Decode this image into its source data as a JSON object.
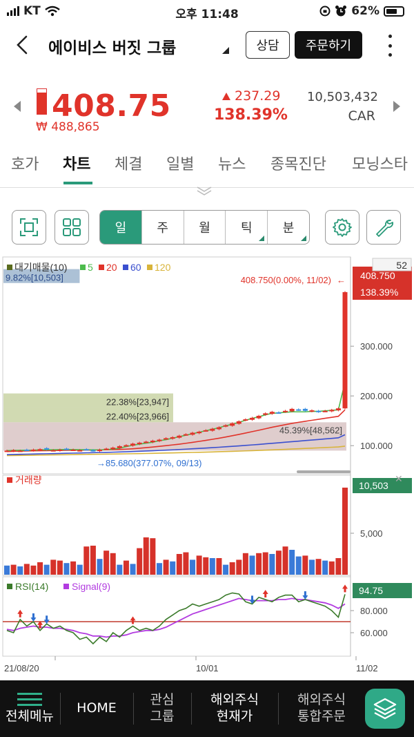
{
  "status_bar": {
    "carrier": "KT",
    "time": "오후 11:48",
    "battery": "62%",
    "icons": [
      "signal-icon",
      "wifi-icon",
      "rotation-lock-icon",
      "alarm-icon",
      "battery-icon"
    ]
  },
  "header": {
    "title": "에이비스 버짓 그룹",
    "consult_label": "상담",
    "order_label": "주문하기",
    "icons": [
      "back-chevron-icon",
      "dropdown-caret-icon",
      "more-vertical-icon"
    ]
  },
  "quote": {
    "price": "408.75",
    "krw_price": "₩ 488,865",
    "change": "237.29",
    "change_pct": "138.39%",
    "volume": "10,503,432",
    "ticker": "CAR",
    "day_range_fill": 0.85,
    "colors": {
      "up": "#e0332a",
      "accent": "#2a9a7a"
    }
  },
  "tabs": [
    {
      "label": "호가",
      "active": false
    },
    {
      "label": "차트",
      "active": true
    },
    {
      "label": "체결",
      "active": false
    },
    {
      "label": "일별",
      "active": false
    },
    {
      "label": "뉴스",
      "active": false
    },
    {
      "label": "종목진단",
      "active": false
    },
    {
      "label": "모닝스타",
      "active": false
    }
  ],
  "toolbar": {
    "periods": [
      {
        "label": "일",
        "active": true,
        "has_menu": false
      },
      {
        "label": "주",
        "active": false,
        "has_menu": false
      },
      {
        "label": "월",
        "active": false,
        "has_menu": false
      },
      {
        "label": "틱",
        "active": false,
        "has_menu": true
      },
      {
        "label": "분",
        "active": false,
        "has_menu": true
      }
    ],
    "icons": [
      "fullscreen-icon",
      "grid-layout-icon",
      "settings-gear-icon",
      "wrench-icon"
    ]
  },
  "chart_data": [
    {
      "type": "candlestick",
      "panel": "price",
      "legend": [
        {
          "name": "대기매물(10)",
          "color": "#5a6b1e"
        },
        {
          "name": "5",
          "color": "#4cbb4c"
        },
        {
          "name": "20",
          "color": "#e0332a"
        },
        {
          "name": "60",
          "color": "#3a4fcf"
        },
        {
          "name": "120",
          "color": "#d8b43a"
        }
      ],
      "ylim": [
        60,
        460
      ],
      "y_ticks": [
        "300.000",
        "200.000",
        "100.000"
      ],
      "x_ticks": [
        "21/08/20",
        "10/01",
        "11/02"
      ],
      "current_badge": {
        "price": "408.750",
        "pct": "138.39%"
      },
      "visible_count": "52",
      "high_label": "408.750(0.00%, 11/02)",
      "low_label": "85.680(377.07%, 09/13)",
      "volume_profile": [
        {
          "label": "9.82%[10,503]",
          "price_from": 427,
          "price_to": 455
        },
        {
          "label": "22.38%[23,947]",
          "price_from": 176,
          "price_to": 205
        },
        {
          "label": "22.40%[23,966]",
          "price_from": 147,
          "price_to": 176
        },
        {
          "label": "45.39%[48,562]",
          "price_from": 90,
          "price_to": 147
        }
      ],
      "close": [
        90,
        91,
        90,
        91,
        92,
        93,
        92,
        91,
        92,
        93,
        92,
        91,
        92,
        90,
        92,
        94,
        96,
        99,
        101,
        104,
        106,
        108,
        110,
        112,
        115,
        117,
        120,
        123,
        126,
        128,
        131,
        134,
        137,
        141,
        145,
        149,
        153,
        156,
        160,
        165,
        168,
        166,
        170,
        174,
        172,
        170,
        171,
        168,
        170,
        172,
        175,
        408.75
      ],
      "ma5": [
        90,
        90.5,
        90.6,
        90.8,
        91,
        91.5,
        91.7,
        91.7,
        92,
        92.2,
        92,
        91.8,
        91.8,
        91.6,
        91.4,
        92,
        93,
        95,
        98,
        101,
        103,
        105,
        107,
        110,
        112,
        115,
        118,
        121,
        124,
        127,
        130,
        133,
        136,
        140,
        143,
        147,
        151,
        155,
        158,
        162,
        165,
        166,
        167,
        168,
        168,
        168,
        169,
        169,
        170,
        171,
        172,
        228
      ],
      "ma20": [
        88,
        88.5,
        89,
        89.2,
        89.5,
        89.8,
        90,
        90.2,
        90.4,
        90.6,
        90.8,
        91,
        91,
        91.2,
        91.4,
        91.6,
        92,
        92.4,
        93,
        93.8,
        94.8,
        96,
        97.2,
        98.6,
        100,
        101.5,
        103,
        104.8,
        106.6,
        108.6,
        110.6,
        112.8,
        115,
        117.4,
        120,
        122.6,
        125.4,
        128.2,
        131,
        134,
        137,
        139.6,
        142.2,
        144.8,
        147,
        149,
        151,
        153,
        155,
        157,
        159,
        172
      ],
      "ma60": [
        82,
        82.3,
        82.6,
        82.9,
        83.2,
        83.5,
        83.8,
        84.1,
        84.4,
        84.7,
        85,
        85.3,
        85.6,
        85.9,
        86.2,
        86.5,
        86.9,
        87.3,
        87.7,
        88.2,
        88.7,
        89.2,
        89.8,
        90.4,
        91,
        91.6,
        92.3,
        93,
        93.7,
        94.4,
        95.2,
        96,
        96.8,
        97.7,
        98.6,
        99.5,
        100.5,
        101.5,
        102.5,
        103.6,
        104.7,
        105.8,
        106.9,
        108,
        109.1,
        110.2,
        111.3,
        112.4,
        113.5,
        114.6,
        115.8,
        122
      ],
      "ma120": [
        80,
        80.2,
        80.4,
        80.6,
        80.8,
        81,
        81.2,
        81.4,
        81.6,
        81.8,
        82,
        82.2,
        82.4,
        82.6,
        82.8,
        83,
        83.2,
        83.4,
        83.6,
        83.8,
        84,
        84.3,
        84.6,
        84.9,
        85.2,
        85.5,
        85.8,
        86.1,
        86.4,
        86.7,
        87,
        87.4,
        87.8,
        88.2,
        88.6,
        89,
        89.5,
        90,
        90.5,
        91,
        91.5,
        92,
        92.6,
        93.2,
        93.8,
        94.4,
        95,
        95.6,
        96.2,
        96.8,
        97.4,
        99
      ]
    },
    {
      "type": "bar",
      "panel": "volume",
      "legend": [
        {
          "name": "거래량",
          "color": "#e0332a"
        }
      ],
      "current_badge": "10,503",
      "y_ticks": [
        "5,000"
      ],
      "ylim": [
        0,
        11000
      ],
      "values": [
        1100,
        1200,
        1000,
        1300,
        1100,
        1500,
        1200,
        1800,
        1700,
        1400,
        1600,
        1200,
        3400,
        3500,
        1900,
        2900,
        2600,
        1200,
        1700,
        1300,
        3200,
        4500,
        4400,
        1400,
        1800,
        1600,
        2500,
        2700,
        1800,
        2300,
        2100,
        2000,
        2000,
        1200,
        1500,
        1800,
        2600,
        2300,
        2600,
        2700,
        2500,
        2900,
        3400,
        3000,
        2200,
        2300,
        1800,
        1900,
        1700,
        1600,
        2000,
        10503
      ],
      "up": [
        false,
        true,
        false,
        true,
        true,
        true,
        false,
        true,
        true,
        false,
        true,
        false,
        true,
        true,
        false,
        true,
        true,
        false,
        true,
        false,
        true,
        true,
        true,
        false,
        true,
        false,
        true,
        true,
        false,
        true,
        true,
        false,
        true,
        false,
        true,
        true,
        true,
        false,
        true,
        true,
        false,
        true,
        true,
        false,
        false,
        true,
        false,
        true,
        false,
        true,
        true,
        true
      ]
    },
    {
      "type": "line",
      "panel": "rsi",
      "legend": [
        {
          "name": "RSI(14)",
          "color": "#3a7a2a"
        },
        {
          "name": "Signal(9)",
          "color": "#b23be0"
        }
      ],
      "current_badge": "94.75",
      "y_ticks": [
        "80.000",
        "60.000"
      ],
      "ylim": [
        40,
        105
      ],
      "reference_level": 70,
      "rsi": [
        62,
        60,
        72,
        66,
        70,
        62,
        68,
        64,
        66,
        62,
        60,
        54,
        56,
        50,
        56,
        52,
        60,
        56,
        62,
        66,
        62,
        64,
        62,
        66,
        72,
        76,
        80,
        82,
        86,
        84,
        86,
        88,
        90,
        94,
        96,
        95,
        88,
        86,
        92,
        90,
        88,
        92,
        94,
        94,
        88,
        90,
        88,
        86,
        84,
        80,
        74,
        94.75
      ],
      "signal": [
        63,
        62,
        64,
        65,
        66,
        65,
        65,
        64,
        64,
        63,
        62,
        60,
        59,
        57,
        57,
        56,
        57,
        57,
        58,
        60,
        61,
        62,
        62,
        63,
        65,
        68,
        71,
        74,
        77,
        79,
        81,
        83,
        85,
        87,
        89,
        91,
        90,
        89,
        89,
        89,
        89,
        90,
        90,
        91,
        90,
        90,
        89,
        88,
        87,
        85,
        82,
        86
      ]
    }
  ],
  "bottom_nav": {
    "menu_label": "전체메뉴",
    "home_label": "HOME",
    "watch_label_1": "관심",
    "watch_label_2": "그룹",
    "overseas_cur_1": "해외주식",
    "overseas_cur_2": "현재가",
    "overseas_order_1": "해외주식",
    "overseas_order_2": "통합주문"
  }
}
